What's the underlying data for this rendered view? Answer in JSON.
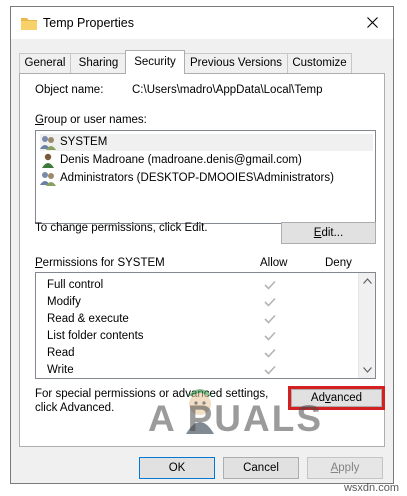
{
  "window": {
    "title": "Temp Properties",
    "close_glyph": "close-icon"
  },
  "tabs": [
    {
      "label": "General"
    },
    {
      "label": "Sharing"
    },
    {
      "label": "Security",
      "active": true
    },
    {
      "label": "Previous Versions"
    },
    {
      "label": "Customize"
    }
  ],
  "security": {
    "object_name_label": "Object name:",
    "object_name_value": "C:\\Users\\madro\\AppData\\Local\\Temp",
    "group_label": "Group or user names:",
    "users": [
      {
        "name": "SYSTEM",
        "icon": "group-icon",
        "selected": true
      },
      {
        "name": "Denis Madroane (madroane.denis@gmail.com)",
        "icon": "user-icon",
        "selected": false
      },
      {
        "name": "Administrators (DESKTOP-DMOOIES\\Administrators)",
        "icon": "group-icon",
        "selected": false
      }
    ],
    "change_permissions_text": "To change permissions, click Edit.",
    "edit_button": "Edit...",
    "permissions_label": "Permissions for SYSTEM",
    "allow_header": "Allow",
    "deny_header": "Deny",
    "permissions": [
      {
        "name": "Full control",
        "allow": true,
        "deny": false
      },
      {
        "name": "Modify",
        "allow": true,
        "deny": false
      },
      {
        "name": "Read & execute",
        "allow": true,
        "deny": false
      },
      {
        "name": "List folder contents",
        "allow": true,
        "deny": false
      },
      {
        "name": "Read",
        "allow": true,
        "deny": false
      },
      {
        "name": "Write",
        "allow": true,
        "deny": false
      }
    ],
    "special_line1": "For special permissions or advanced settings,",
    "special_line2": "click Advanced.",
    "advanced_button": "Advanced"
  },
  "footer": {
    "ok": "OK",
    "cancel": "Cancel",
    "apply": "Apply"
  },
  "watermark": {
    "brand": "A  PUALS",
    "site": "wsxdn.com"
  },
  "colors": {
    "highlight": "#d32020",
    "check_disabled": "#b4b4b4",
    "primary_border": "#0078d7"
  }
}
